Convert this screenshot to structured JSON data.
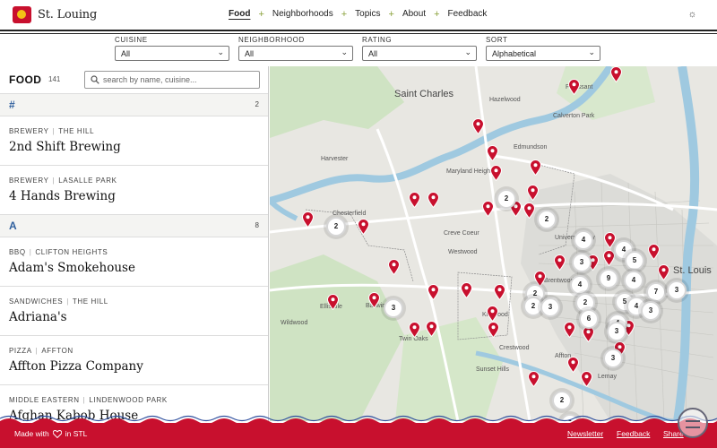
{
  "brand": {
    "name": "St. Louing",
    "accent": "#c8102e"
  },
  "nav": {
    "items": [
      {
        "label": "Food",
        "active": true
      },
      {
        "label": "Neighborhoods",
        "active": false
      },
      {
        "label": "Topics",
        "active": false
      },
      {
        "label": "About",
        "active": false
      },
      {
        "label": "Feedback",
        "active": false
      }
    ],
    "separator": "+",
    "theme_icon": "sun-icon"
  },
  "filters": {
    "cuisine": {
      "label": "CUISINE",
      "value": "All"
    },
    "neighborhood": {
      "label": "NEIGHBORHOOD",
      "value": "All"
    },
    "rating": {
      "label": "RATING",
      "value": "All"
    },
    "sort": {
      "label": "SORT",
      "value": "Alphabetical"
    }
  },
  "panel": {
    "title": "FOOD",
    "count": "141",
    "search_placeholder": "search by name, cuisine...",
    "sections": [
      {
        "letter": "#",
        "count": "2",
        "items": [
          {
            "category": "BREWERY",
            "neighborhood": "THE HILL",
            "name": "2nd Shift Brewing"
          },
          {
            "category": "BREWERY",
            "neighborhood": "LASALLE PARK",
            "name": "4 Hands Brewing"
          }
        ]
      },
      {
        "letter": "A",
        "count": "8",
        "items": [
          {
            "category": "BBQ",
            "neighborhood": "CLIFTON HEIGHTS",
            "name": "Adam's Smokehouse"
          },
          {
            "category": "SANDWICHES",
            "neighborhood": "THE HILL",
            "name": "Adriana's"
          },
          {
            "category": "PIZZA",
            "neighborhood": "AFFTON",
            "name": "Affton Pizza Company"
          },
          {
            "category": "MIDDLE EASTERN",
            "neighborhood": "LINDENWOOD PARK",
            "name": "Afghan Kabob House"
          }
        ]
      }
    ]
  },
  "map": {
    "places": [
      {
        "name": "Saint Charles",
        "size": "big"
      },
      {
        "name": "St. Louis",
        "size": "big"
      },
      {
        "name": "Florissant",
        "size": "small"
      },
      {
        "name": "Hazelwood",
        "size": "small"
      },
      {
        "name": "Calverton Park",
        "size": "small"
      },
      {
        "name": "Edmundson",
        "size": "small"
      },
      {
        "name": "Harvester",
        "size": "small"
      },
      {
        "name": "Maryland Heights",
        "size": "small"
      },
      {
        "name": "Chesterfield",
        "size": "small"
      },
      {
        "name": "Creve Coeur",
        "size": "small"
      },
      {
        "name": "Westwood",
        "size": "small"
      },
      {
        "name": "Wildwood",
        "size": "small"
      },
      {
        "name": "Ellisville",
        "size": "small"
      },
      {
        "name": "Ballwin",
        "size": "small"
      },
      {
        "name": "Kirkwood",
        "size": "small"
      },
      {
        "name": "Twin Oaks",
        "size": "small"
      },
      {
        "name": "Crestwood",
        "size": "small"
      },
      {
        "name": "Sunset Hills",
        "size": "small"
      },
      {
        "name": "Affton",
        "size": "small"
      },
      {
        "name": "Lemay",
        "size": "small"
      },
      {
        "name": "Brentwood",
        "size": "small"
      },
      {
        "name": "University City",
        "size": "small"
      }
    ],
    "clusters": [
      "2",
      "2",
      "2",
      "4",
      "4",
      "3",
      "2",
      "5",
      "4",
      "4",
      "9",
      "7",
      "3",
      "2",
      "5",
      "4",
      "3",
      "2",
      "6",
      "4",
      "3",
      "3",
      "3",
      "3",
      "2",
      "2"
    ]
  },
  "footer": {
    "made_prefix": "Made with",
    "made_suffix": "in STL",
    "heart_icon": "heart-icon",
    "links": [
      "Newsletter",
      "Feedback",
      "Share"
    ]
  }
}
